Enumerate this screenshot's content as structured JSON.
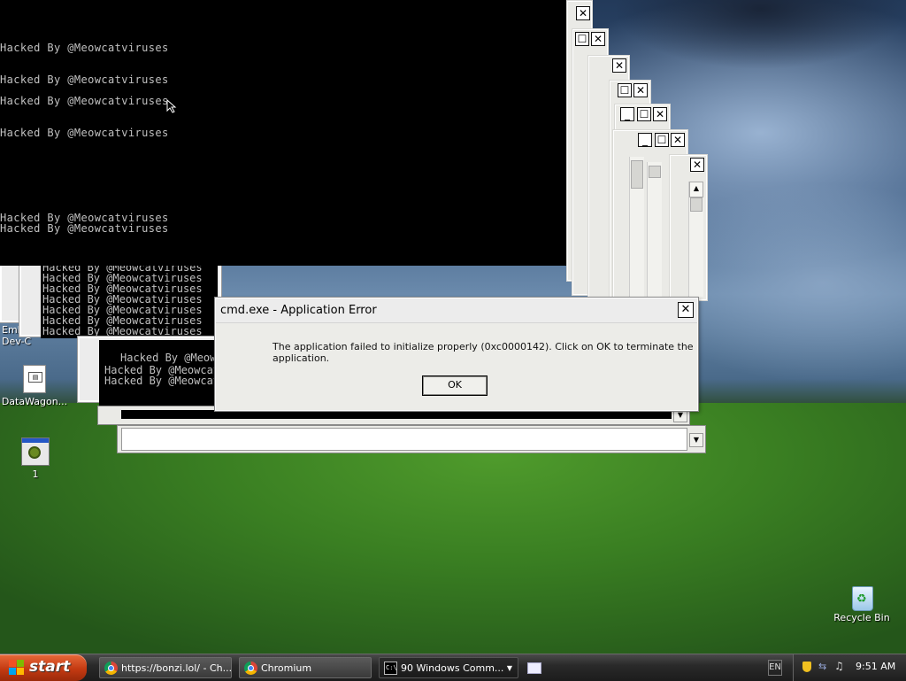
{
  "console": {
    "lines": [
      "Hacked By @Meowcatviruses",
      "Hacked By @Meowcatviruses",
      "Hacked By @Meowcatviruses",
      "Hacked By @Meowcatviruses",
      "Hacked By @Meowcatviruses",
      "Hacked By @Meowcatviruses"
    ],
    "under_lines": [
      "Hacked By @Meowcatviruses",
      "Hacked By @Meowcatviruses",
      "Hacked By @Meowcatviruses",
      "Hacked By @Meowcatviruses",
      "Hacked By @Meowcatviruses",
      "Hacked By @Meowcatviruses",
      "Hacked By @Meowcatviruses"
    ],
    "mid_lines": [
      "Hacked By @Meowcatviruses",
      "Hacked By @Meowcatviruses",
      "Hacked By @Meowcatviruses"
    ]
  },
  "dialog": {
    "title": "cmd.exe - Application Error",
    "message": "The application failed to initialize properly (0xc0000142). Click on OK to terminate the application.",
    "ok_label": "OK",
    "close_glyph": "✕"
  },
  "window_controls": {
    "close": "✕",
    "maximize": "☐",
    "minimize": "_",
    "scroll_up": "▲",
    "scroll_down": "▼"
  },
  "desktop": {
    "icons": [
      {
        "label": "Embarc\nDev-C",
        "icon": "app-icon"
      },
      {
        "label": "DataWagon...",
        "icon": "shortcut-file-icon"
      },
      {
        "label": "1",
        "icon": "gear-window-icon"
      },
      {
        "label": "Recycle Bin",
        "icon": "recycle-bin-icon"
      }
    ]
  },
  "taskbar": {
    "start_label": "start",
    "tasks": [
      {
        "label": "https://bonzi.lol/ - Ch...",
        "icon": "chromium-icon",
        "active": false
      },
      {
        "label": "Chromium",
        "icon": "chromium-icon",
        "active": false
      },
      {
        "label": "90 Windows Comm...",
        "icon": "cmd-icon",
        "active": true
      }
    ],
    "language": "EN",
    "clock": "9:51 AM",
    "tray_icons": [
      "security-shield-icon",
      "network-icon",
      "volume-icon"
    ]
  },
  "colors": {
    "console_bg": "#000000",
    "console_text": "#c0c0c0",
    "taskbar": "#2a2a2a",
    "start_button": "#c43a12"
  }
}
